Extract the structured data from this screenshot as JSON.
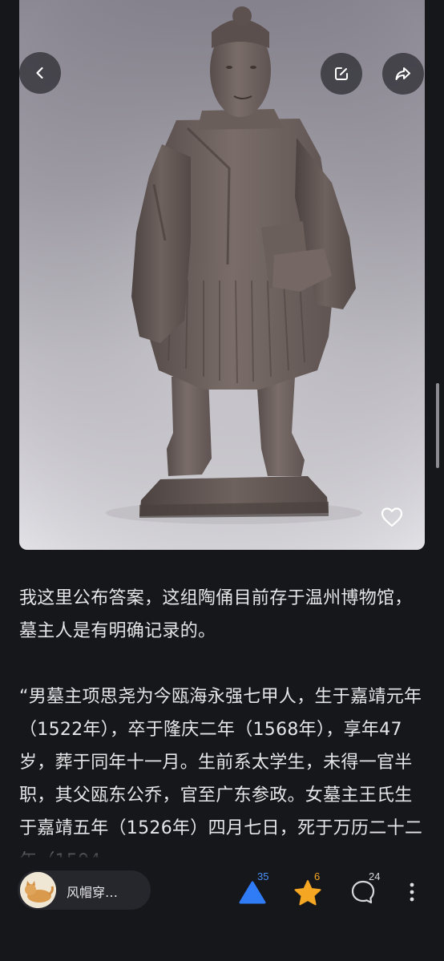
{
  "toolbar": {
    "back_icon": "chevron-left-icon",
    "edit_icon": "edit-icon",
    "share_icon": "share-icon"
  },
  "photo": {
    "like_icon": "heart-icon"
  },
  "article": {
    "paragraph1": "我这里公布答案，这组陶俑目前存于温州博物馆，墓主人是有明确记录的。",
    "paragraph2": "“男墓主项思尧为今瓯海永强七甲人，生于嘉靖元年（1522年），卒于隆庆二年（1568年），享年47岁，葬于同年十一月。生前系太学生，未得一官半职，其父瓯东公乔，官至广东参政。女墓主王氏生于嘉靖五年（1526年）四月七日，死于万历二十二年（1594"
  },
  "bottom_bar": {
    "author_name": "风帽穿…",
    "upvote_count": "35",
    "star_count": "6",
    "comment_count": "24",
    "colors": {
      "upvote": "#2f7cf6",
      "star": "#f5a623",
      "comment": "#d8d8dc"
    }
  }
}
